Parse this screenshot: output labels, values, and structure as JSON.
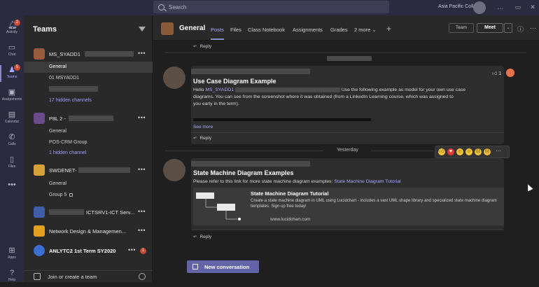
{
  "topbar": {
    "search_placeholder": "Search",
    "org_name": "Asia Pacific College",
    "window_controls": [
      "…",
      "▭",
      "✕"
    ]
  },
  "rail": {
    "items": [
      {
        "label": "Activity",
        "icon": "bell-icon",
        "badge": "2"
      },
      {
        "label": "Chat",
        "icon": "chat-icon"
      },
      {
        "label": "Teams",
        "icon": "teams-icon",
        "badge": "5"
      },
      {
        "label": "Assignments",
        "icon": "assignments-icon"
      },
      {
        "label": "Calendar",
        "icon": "calendar-icon"
      },
      {
        "label": "Calls",
        "icon": "phone-icon"
      },
      {
        "label": "Files",
        "icon": "file-icon"
      },
      {
        "label": "Apps",
        "icon": "apps-icon"
      },
      {
        "label": "Help",
        "icon": "help-icon"
      }
    ],
    "more": "•••"
  },
  "teams_panel": {
    "title": "Teams",
    "teams": [
      {
        "name": "MS_SYADD1",
        "color": "#9a5b3c",
        "dots": "•••",
        "channels": [
          "General",
          "01 MSYADD1",
          "",
          "17 hidden channels"
        ]
      },
      {
        "name": "P8L 2 -",
        "color": "#6a4a8a",
        "dots": "•••",
        "channels": [
          "General",
          "POS-CRM Group",
          "1 hidden channel"
        ]
      },
      {
        "name": "SWDENET-",
        "color": "#d8a23a",
        "dots": "•••",
        "channels": [
          "General",
          "Group 5"
        ]
      },
      {
        "name": "ICTSRV1-ICT Serv...",
        "color": "#3f5da8",
        "dots": "•••"
      },
      {
        "name": "Network Design & Managemen...",
        "color": "#e2a021",
        "dots": "•••"
      },
      {
        "name": "ANLYTC2 1st Term SY2020",
        "color": "#3b6fd3",
        "dots": "•••",
        "badge": "1"
      }
    ],
    "join_label": "Join or create a team"
  },
  "header": {
    "channel_name": "General",
    "tabs": [
      "Posts",
      "Files",
      "Class Notebook",
      "Assignments",
      "Grades",
      "2 more"
    ],
    "team_button": "Team",
    "meet_button": "Meet"
  },
  "feed": {
    "reply_label": "Reply",
    "posts": [
      {
        "subject": "Use Case Diagram Example",
        "greeting": "Hello",
        "mention": "MS_SYADD1",
        "body_1": "Use the following example as model for your own use case",
        "body_2": "diagrams. You can see from the screenshot where it was obtained (from a LinkedIn Learning course, which was assigned to",
        "body_3": "you early in the term).",
        "see_more": "See more",
        "reaction_count": "1"
      },
      {
        "subject": "State Machine Diagram Examples",
        "body": "Please refer to this link for more state machine diagram examples:",
        "link_text": "State Machine Diagram Tutorial",
        "card": {
          "title": "State Machine Diagram Tutorial",
          "description": "Create a state machine diagram in UML using Lucidchart - includes a vast UML shape library and specialized state machine diagram templates. Sign up free today!",
          "url": "www.lucidchart.com"
        }
      }
    ],
    "date_separator": "Yesterday",
    "new_conversation": "New conversation"
  },
  "colors": {
    "accent": "#6264a7",
    "link": "#a9a9ff",
    "rail_bg": "#2b2b3f",
    "panel_bg": "#292929",
    "feed_bg": "#1f1f1f"
  }
}
